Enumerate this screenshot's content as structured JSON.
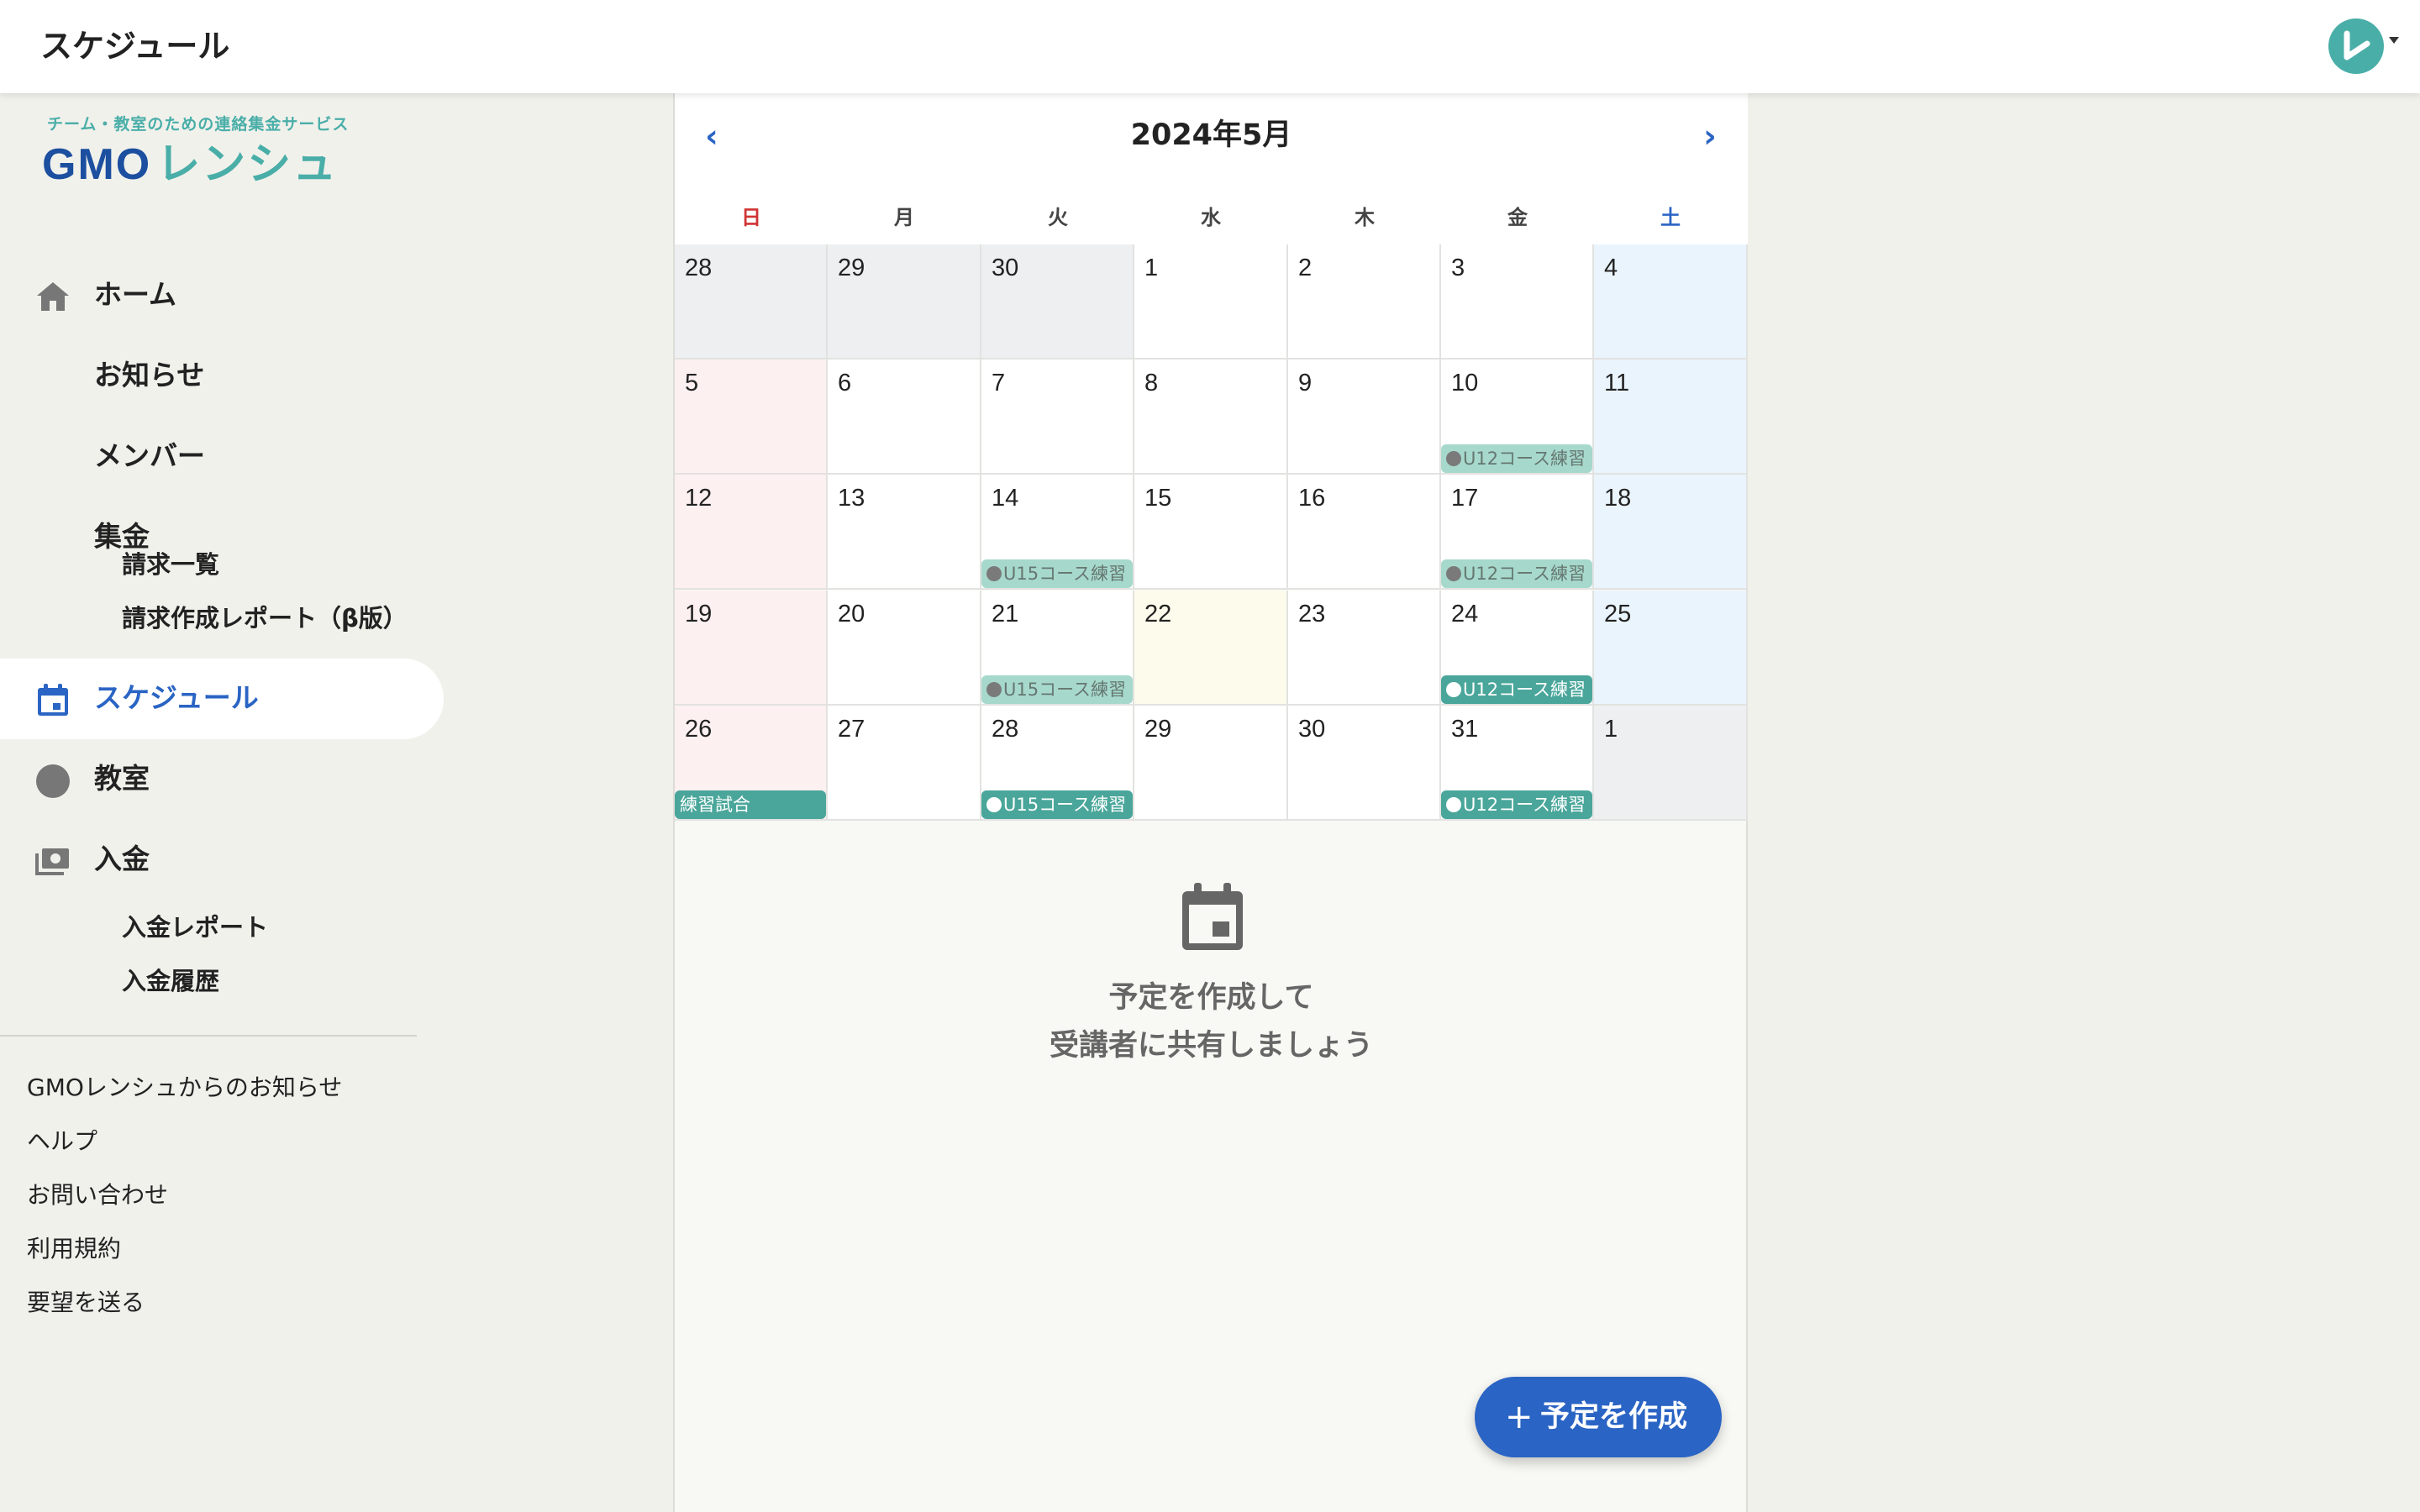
{
  "header": {
    "title": "スケジュール"
  },
  "logo": {
    "tagline": "チーム・教室のための連絡集金サービス",
    "brand_gmo": "GMO",
    "brand_name": "レンシュ"
  },
  "sidebar": {
    "home": "ホーム",
    "news": "お知らせ",
    "members": "メンバー",
    "billing": "集金",
    "billing_list": "請求一覧",
    "billing_report": "請求作成レポート（β版）",
    "schedule": "スケジュール",
    "classroom": "教室",
    "deposit": "入金",
    "deposit_report": "入金レポート",
    "deposit_history": "入金履歴"
  },
  "footer_links": {
    "gmo_news": "GMOレンシュからのお知らせ",
    "help": "ヘルプ",
    "contact": "お問い合わせ",
    "terms": "利用規約",
    "feedback": "要望を送る"
  },
  "calendar": {
    "month_label": "2024年5月",
    "prev": "‹",
    "next": "›",
    "weekdays": [
      "日",
      "月",
      "火",
      "水",
      "木",
      "金",
      "土"
    ],
    "weeks": [
      [
        {
          "d": "28"
        },
        {
          "d": "29"
        },
        {
          "d": "30"
        },
        {
          "d": "1"
        },
        {
          "d": "2"
        },
        {
          "d": "3"
        },
        {
          "d": "4"
        }
      ],
      [
        {
          "d": "5"
        },
        {
          "d": "6"
        },
        {
          "d": "7"
        },
        {
          "d": "8"
        },
        {
          "d": "9"
        },
        {
          "d": "10",
          "e": "U12コース練習"
        },
        {
          "d": "11"
        }
      ],
      [
        {
          "d": "12"
        },
        {
          "d": "13"
        },
        {
          "d": "14",
          "e": "U15コース練習"
        },
        {
          "d": "15"
        },
        {
          "d": "16"
        },
        {
          "d": "17",
          "e": "U12コース練習"
        },
        {
          "d": "18"
        }
      ],
      [
        {
          "d": "19"
        },
        {
          "d": "20"
        },
        {
          "d": "21",
          "e": "U15コース練習"
        },
        {
          "d": "22"
        },
        {
          "d": "23"
        },
        {
          "d": "24",
          "e": "U12コース練習"
        },
        {
          "d": "25"
        }
      ],
      [
        {
          "d": "26",
          "e": "練習試合"
        },
        {
          "d": "27"
        },
        {
          "d": "28",
          "e": "U15コース練習"
        },
        {
          "d": "29"
        },
        {
          "d": "30"
        },
        {
          "d": "31",
          "e": "U12コース練習"
        },
        {
          "d": "1"
        }
      ]
    ]
  },
  "empty_state": {
    "line1": "予定を作成して",
    "line2": "受講者に共有しましょう"
  },
  "fab": {
    "plus": "+",
    "label": "予定を作成"
  },
  "colors": {
    "accent": "#2a64c4",
    "brand_teal": "#4aaea8",
    "event_pale": "#a6d9cc",
    "event_solid": "#4aa69a"
  }
}
